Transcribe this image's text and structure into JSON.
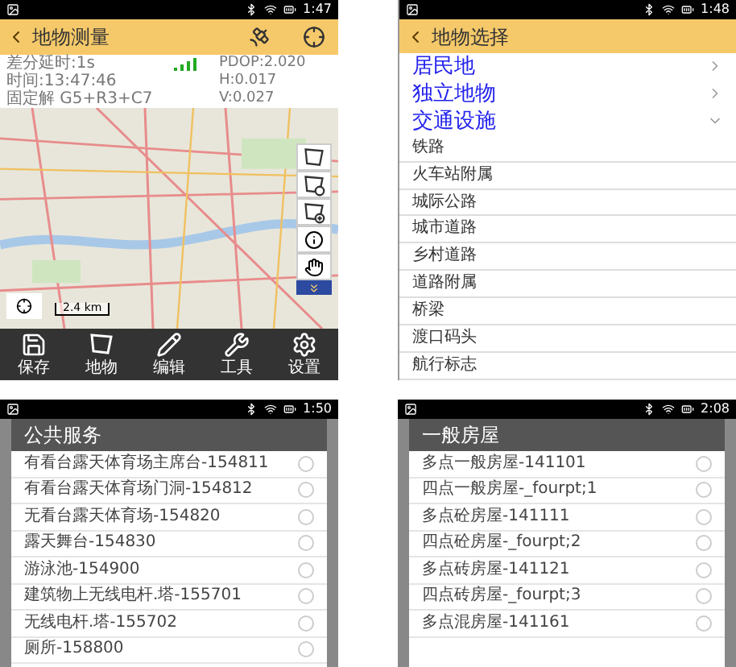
{
  "screens": [
    {
      "kind": "map",
      "status_time": "1:47",
      "title": "地物测量",
      "info": [
        [
          "差分延时:1s",
          "PDOP:2.020"
        ],
        [
          "时间:13:47:46",
          "H:0.017"
        ],
        [
          "固定解  G5+R3+C7",
          "V:0.027"
        ]
      ],
      "scale": "2.4 km",
      "toolbar": [
        "保存",
        "地物",
        "编辑",
        "工具",
        "设置"
      ]
    },
    {
      "kind": "categories",
      "status_time": "1:48",
      "title": "地物选择",
      "groups": [
        {
          "label": "居民地",
          "expanded": false
        },
        {
          "label": "独立地物",
          "expanded": false
        },
        {
          "label": "交通设施",
          "expanded": true
        }
      ],
      "items": [
        "铁路",
        "火车站附属",
        "城际公路",
        "城市道路",
        "乡村道路",
        "道路附属",
        "桥梁",
        "渡口码头",
        "航行标志"
      ]
    },
    {
      "kind": "dialog",
      "status_time": "1:50",
      "title": "公共服务",
      "options": [
        {
          "label": "有看台露天体育场主席台-154811",
          "selected": false
        },
        {
          "label": "有看台露天体育场门洞-154812",
          "selected": false
        },
        {
          "label": "无看台露天体育场-154820",
          "selected": false
        },
        {
          "label": "露天舞台-154830",
          "selected": false
        },
        {
          "label": "游泳池-154900",
          "selected": false
        },
        {
          "label": "建筑物上无线电杆.塔-155701",
          "selected": false
        },
        {
          "label": "无线电杆.塔-155702",
          "selected": false
        },
        {
          "label": "厕所-158800",
          "selected": false
        }
      ]
    },
    {
      "kind": "dialog",
      "status_time": "2:08",
      "title": "一般房屋",
      "options": [
        {
          "label": "多点一般房屋-141101",
          "selected": false
        },
        {
          "label": "四点一般房屋-_fourpt;1",
          "selected": false
        },
        {
          "label": "多点砼房屋-141111",
          "selected": false
        },
        {
          "label": "四点砼房屋-_fourpt;2",
          "selected": false
        },
        {
          "label": "多点砖房屋-141121",
          "selected": false
        },
        {
          "label": "四点砖房屋-_fourpt;3",
          "selected": false
        },
        {
          "label": "多点混房屋-141161",
          "selected": false
        }
      ]
    }
  ]
}
